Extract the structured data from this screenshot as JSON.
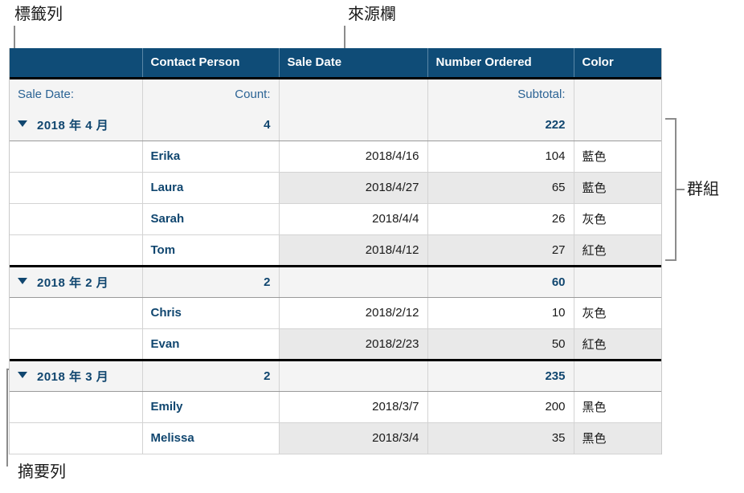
{
  "annotations": {
    "label_row": "標籤列",
    "source_column": "來源欄",
    "group": "群組",
    "summary_row": "摘要列"
  },
  "table": {
    "columns": [
      {
        "key": "label",
        "header": ""
      },
      {
        "key": "person",
        "header": "Contact Person"
      },
      {
        "key": "date",
        "header": "Sale Date"
      },
      {
        "key": "number",
        "header": "Number Ordered"
      },
      {
        "key": "color",
        "header": "Color"
      }
    ],
    "field_row": {
      "label": "Sale Date:",
      "person": "Count:",
      "date": "",
      "number": "Subtotal:",
      "color": ""
    },
    "disclosure_glyph": "▼",
    "groups": [
      {
        "title": "2018 年 4 月",
        "count": "4",
        "subtotal": "222",
        "rows": [
          {
            "person": "Erika",
            "date": "2018/4/16",
            "number": "104",
            "color": "藍色"
          },
          {
            "person": "Laura",
            "date": "2018/4/27",
            "number": "65",
            "color": "藍色"
          },
          {
            "person": "Sarah",
            "date": "2018/4/4",
            "number": "26",
            "color": "灰色"
          },
          {
            "person": "Tom",
            "date": "2018/4/12",
            "number": "27",
            "color": "紅色"
          }
        ]
      },
      {
        "title": "2018 年 2 月",
        "count": "2",
        "subtotal": "60",
        "rows": [
          {
            "person": "Chris",
            "date": "2018/2/12",
            "number": "10",
            "color": "灰色"
          },
          {
            "person": "Evan",
            "date": "2018/2/23",
            "number": "50",
            "color": "紅色"
          }
        ]
      },
      {
        "title": "2018 年 3 月",
        "count": "2",
        "subtotal": "235",
        "rows": [
          {
            "person": "Emily",
            "date": "2018/3/7",
            "number": "200",
            "color": "黑色"
          },
          {
            "person": "Melissa",
            "date": "2018/3/4",
            "number": "35",
            "color": "黑色"
          }
        ]
      }
    ]
  },
  "colors": {
    "header_blue": "#0f4c77",
    "accent_text_blue": "#10466f",
    "field_text_blue": "#2b6394",
    "row_shade": "#e9e9e9",
    "group_shade": "#f4f4f4",
    "callout_gray": "#8c8c8c"
  }
}
